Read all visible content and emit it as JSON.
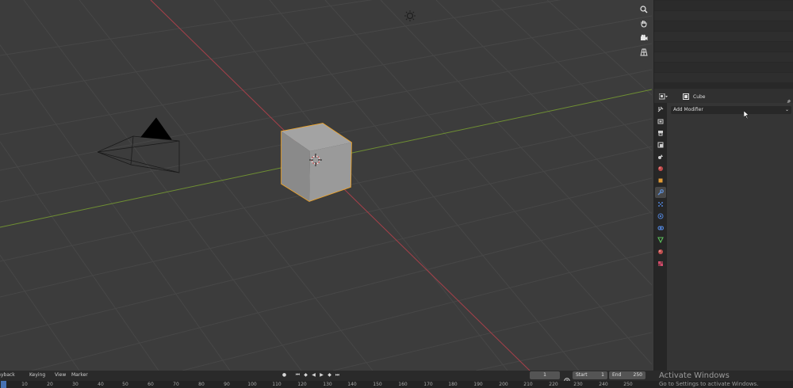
{
  "viewport": {
    "nav_gizmo": [
      "zoom-icon",
      "hand-pan-icon",
      "camera-view-icon",
      "grid-ortho-icon"
    ]
  },
  "properties": {
    "object_name": "Cube",
    "add_modifier_label": "Add Modifier",
    "tabs": [
      "tool",
      "render",
      "output",
      "view-layer",
      "scene",
      "world",
      "object",
      "modifier",
      "particles",
      "physics",
      "constraints",
      "data",
      "material",
      "texture"
    ],
    "active_tab": "modifier"
  },
  "timeline": {
    "menus": [
      "Playback",
      "Keying",
      "View",
      "Marker"
    ],
    "current_frame": "1",
    "start_label": "Start",
    "start_value": "1",
    "end_label": "End",
    "end_value": "250",
    "ruler_ticks": [
      "0",
      "10",
      "20",
      "30",
      "40",
      "50",
      "60",
      "70",
      "80",
      "90",
      "100",
      "110",
      "120",
      "130",
      "140",
      "150",
      "160",
      "170",
      "180",
      "190",
      "200",
      "210",
      "220",
      "230",
      "240",
      "250"
    ]
  },
  "watermark": {
    "title": "Activate Windows",
    "subtitle": "Go to Settings to activate Windows."
  },
  "colors": {
    "selection_outline": "#f5a623",
    "x_axis": "#a8404a",
    "y_axis": "#6f8f33",
    "active_tab": "#4772b3"
  }
}
